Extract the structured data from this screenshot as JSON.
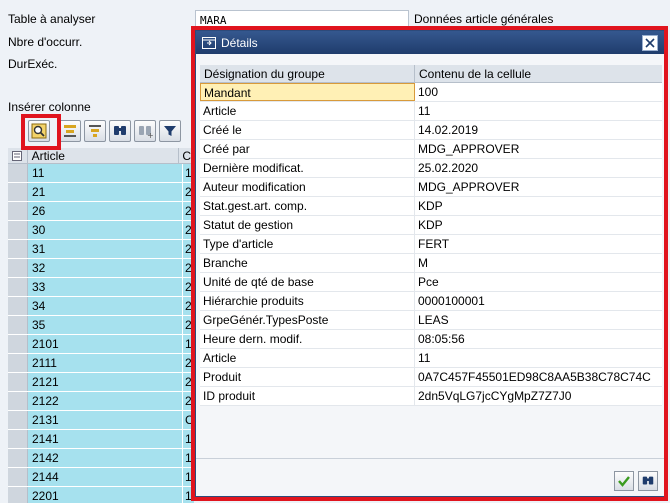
{
  "header": {
    "table_label": "Table à analyser",
    "table_value": "MARA",
    "table_desc": "Données article générales",
    "occurrences_label": "Nbre d'occurr.",
    "runtime_label": "DurExéc.",
    "insert_column_label": "Insérer colonne"
  },
  "toolbar": {
    "buttons": [
      "details-icon",
      "sort-ascending-icon",
      "filter-icon",
      "find-icon",
      "find-next-icon",
      "funnel-icon"
    ]
  },
  "grid": {
    "column": "Article",
    "column2_initial": "C",
    "rows": [
      {
        "article": "11",
        "c2": "1"
      },
      {
        "article": "21",
        "c2": "2"
      },
      {
        "article": "26",
        "c2": "2"
      },
      {
        "article": "30",
        "c2": "2"
      },
      {
        "article": "31",
        "c2": "2"
      },
      {
        "article": "32",
        "c2": "2"
      },
      {
        "article": "33",
        "c2": "2"
      },
      {
        "article": "34",
        "c2": "2"
      },
      {
        "article": "35",
        "c2": "2"
      },
      {
        "article": "2101",
        "c2": "1"
      },
      {
        "article": "2111",
        "c2": "2"
      },
      {
        "article": "2121",
        "c2": "2"
      },
      {
        "article": "2122",
        "c2": "2"
      },
      {
        "article": "2131",
        "c2": "C"
      },
      {
        "article": "2141",
        "c2": "1"
      },
      {
        "article": "2142",
        "c2": "1"
      },
      {
        "article": "2144",
        "c2": "1"
      },
      {
        "article": "2201",
        "c2": "1"
      }
    ]
  },
  "dialog": {
    "title": "Détails",
    "col_group": "Désignation du groupe",
    "col_content": "Contenu de la cellule",
    "rows": [
      {
        "name": "Mandant",
        "value": "100"
      },
      {
        "name": "Article",
        "value": "11"
      },
      {
        "name": "Créé le",
        "value": "14.02.2019"
      },
      {
        "name": "Créé par",
        "value": "MDG_APPROVER"
      },
      {
        "name": "Dernière modificat.",
        "value": "25.02.2020"
      },
      {
        "name": "Auteur modification",
        "value": "MDG_APPROVER"
      },
      {
        "name": "Stat.gest.art. comp.",
        "value": "KDP"
      },
      {
        "name": "Statut de gestion",
        "value": "KDP"
      },
      {
        "name": "Type d'article",
        "value": "FERT"
      },
      {
        "name": "Branche",
        "value": "M"
      },
      {
        "name": "Unité de qté de base",
        "value": "Pce"
      },
      {
        "name": "Hiérarchie produits",
        "value": "0000100001"
      },
      {
        "name": "GrpeGénér.TypesPoste",
        "value": "LEAS"
      },
      {
        "name": "Heure dern. modif.",
        "value": "08:05:56"
      },
      {
        "name": "Article",
        "value": "11"
      },
      {
        "name": "Produit",
        "value": "0A7C457F45501ED98C8AA5B38C78C74C"
      },
      {
        "name": "ID produit",
        "value": "2dn5VqLG7jcCYgMpZ7Z7J0"
      }
    ]
  },
  "colors": {
    "highlight": "#e0141e",
    "row_blue": "#a6e1ee",
    "title_blue": "#2a4a7e"
  }
}
